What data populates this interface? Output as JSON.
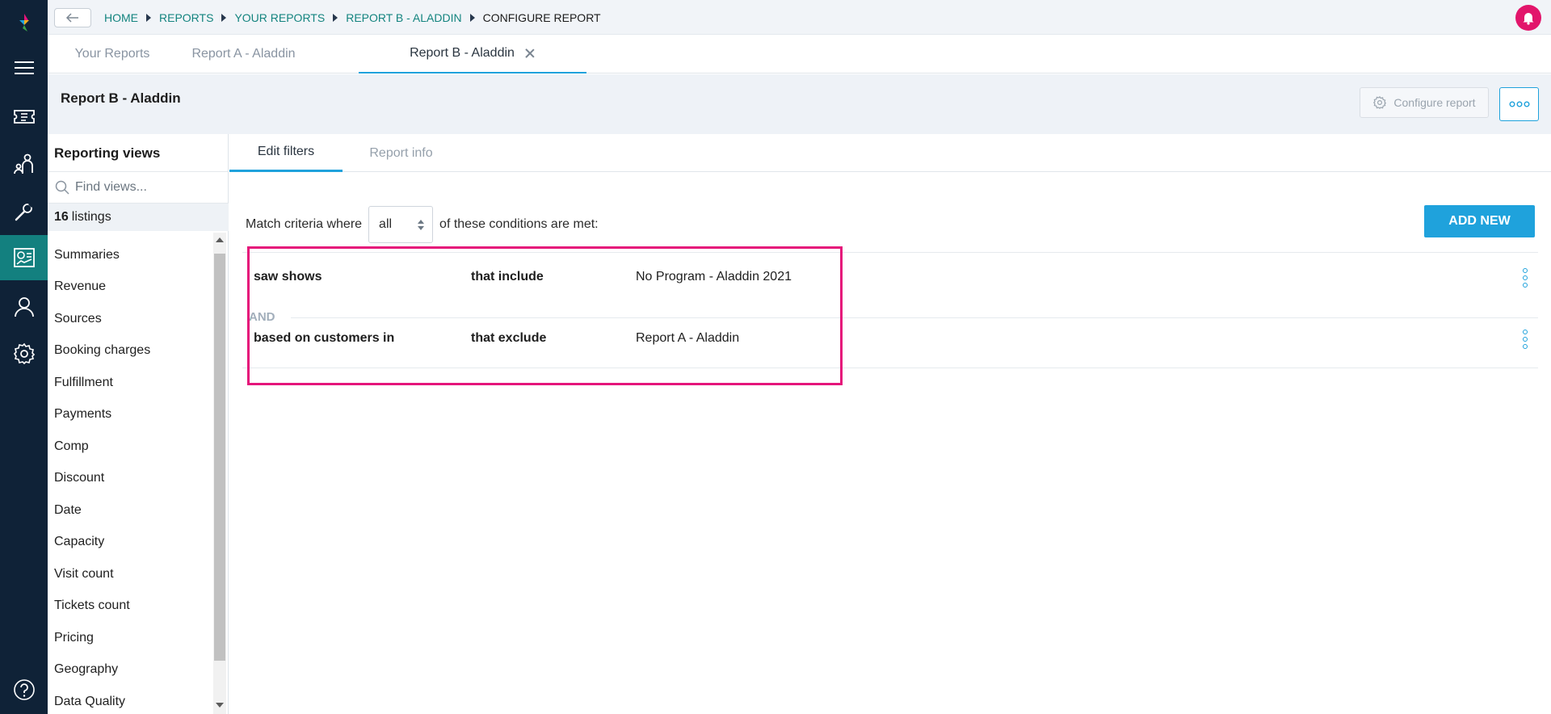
{
  "breadcrumb": {
    "items": [
      "HOME",
      "REPORTS",
      "YOUR REPORTS",
      "REPORT B - ALADDIN"
    ],
    "current": "CONFIGURE REPORT"
  },
  "report_tabs": {
    "tab1": "Your Reports",
    "tab2": "Report A - Aladdin",
    "tab3": "Report B - Aladdin"
  },
  "header": {
    "title": "Report B - Aladdin",
    "configure_label": "Configure report"
  },
  "views_panel": {
    "title": "Reporting views",
    "search_placeholder": "Find views...",
    "listings_count": "16",
    "listings_label": "listings",
    "items": [
      "Summaries",
      "Revenue",
      "Sources",
      "Booking charges",
      "Fulfillment",
      "Payments",
      "Comp",
      "Discount",
      "Date",
      "Capacity",
      "Visit count",
      "Tickets count",
      "Pricing",
      "Geography",
      "Data Quality"
    ]
  },
  "subtabs": {
    "edit_filters": "Edit filters",
    "report_info": "Report info"
  },
  "criteria": {
    "prefix": "Match criteria where",
    "selected": "all",
    "suffix": "of these conditions are met:",
    "add_new": "ADD NEW"
  },
  "conditions": [
    {
      "field": "saw shows",
      "operator": "that include",
      "value": "No Program - Aladdin 2021"
    },
    {
      "field": "based on customers in",
      "operator": "that exclude",
      "value": "Report A - Aladdin"
    }
  ],
  "connector": "AND",
  "colors": {
    "rail": "#0f2237",
    "rail_active": "#13807f",
    "accent": "#1fa2dc",
    "breadcrumb_link": "#14847f",
    "highlight": "#e5157a",
    "bell": "#e2156b"
  },
  "icons": [
    "logo-icon",
    "menu-icon",
    "ticket-icon",
    "people-icon",
    "tools-icon",
    "report-icon",
    "user-icon",
    "settings-icon",
    "help-icon",
    "bell-icon",
    "back-arrow-icon",
    "close-icon",
    "gear-icon",
    "more-icon",
    "search-icon"
  ]
}
